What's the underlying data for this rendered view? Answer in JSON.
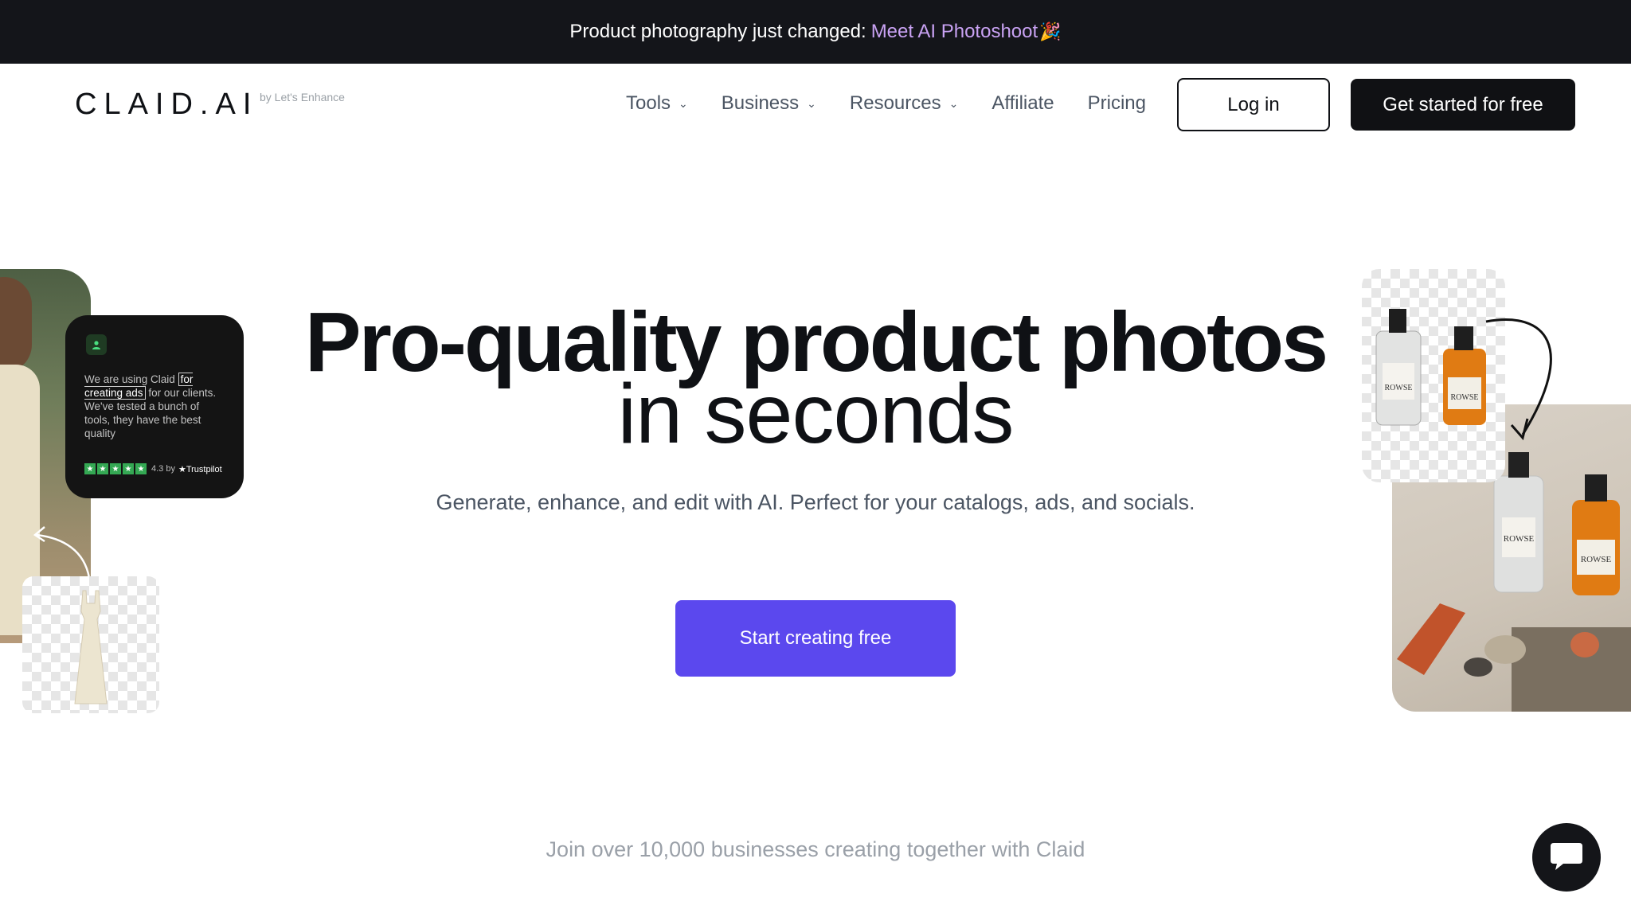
{
  "banner": {
    "text": "Product photography just changed:",
    "link": "Meet AI Photoshoot",
    "emoji": "🎉"
  },
  "header": {
    "logo": "CLAID.AI",
    "logo_by": "by Let's Enhance",
    "nav": [
      {
        "label": "Tools",
        "has_dropdown": true
      },
      {
        "label": "Business",
        "has_dropdown": true
      },
      {
        "label": "Resources",
        "has_dropdown": true
      },
      {
        "label": "Affiliate",
        "has_dropdown": false
      },
      {
        "label": "Pricing",
        "has_dropdown": false
      }
    ],
    "login": "Log in",
    "get_started": "Get started for free"
  },
  "hero": {
    "title_line1": "Pro-quality product photos",
    "title_line2": "in seconds",
    "subtitle": "Generate, enhance, and edit with AI. Perfect for your catalogs, ads, and socials.",
    "cta": "Start creating free"
  },
  "review": {
    "text_before": "We are using Claid",
    "highlight": "for creating ads",
    "text_after": "for our clients. We've tested a bunch of tools, they have the best quality",
    "rating": "4.3 by",
    "source": "★Trustpilot",
    "stars": 5
  },
  "product_labels": {
    "bottle": "ROWSE"
  },
  "social_proof": "Join over 10,000 businesses creating together with Claid",
  "colors": {
    "banner_bg": "#14151a",
    "banner_link": "#c9a2f3",
    "cta_bg": "#5b48ee",
    "button_dark": "#101114",
    "trustpilot_green": "#34a853"
  },
  "icons": {
    "chevron": "chevron-down-icon",
    "chat": "chat-icon",
    "user": "user-icon",
    "arrow": "curved-arrow-icon"
  }
}
